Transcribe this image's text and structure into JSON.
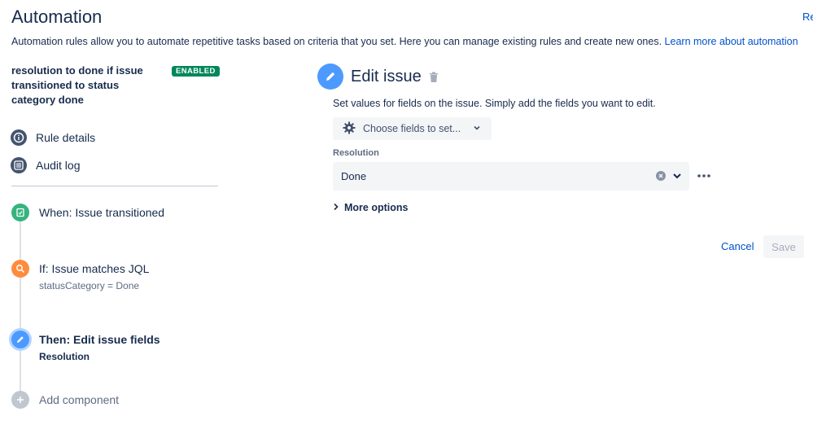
{
  "header": {
    "title": "Automation",
    "top_right_link": "Re",
    "intro_text": "Automation rules allow you to automate repetitive tasks based on criteria that you set. Here you can manage existing rules and create new ones.",
    "intro_link": "Learn more about automation"
  },
  "rule": {
    "name": "resolution to done if issue transitioned to status category done",
    "status_badge": "ENABLED"
  },
  "nav": {
    "rule_details": "Rule details",
    "audit_log": "Audit log"
  },
  "steps": [
    {
      "title": "When: Issue transitioned",
      "subtitle": "",
      "color": "#36b37e",
      "icon": "trigger-icon"
    },
    {
      "title": "If: Issue matches JQL",
      "subtitle": "statusCategory = Done",
      "color": "#ff8b3d",
      "icon": "search-icon"
    },
    {
      "title": "Then: Edit issue fields",
      "subtitle": "Resolution",
      "color": "#4c9aff",
      "icon": "pencil-icon"
    },
    {
      "title": "Add component",
      "subtitle": "",
      "color": "#c1c7d0",
      "icon": "plus-icon"
    }
  ],
  "editor": {
    "title": "Edit issue",
    "help_text": "Set values for fields on the issue. Simply add the fields you want to edit.",
    "choose_fields_label": "Choose fields to set...",
    "resolution_label": "Resolution",
    "resolution_value": "Done",
    "more_options_label": "More options",
    "cancel_label": "Cancel",
    "save_label": "Save"
  },
  "colors": {
    "accent": "#0052cc",
    "enabled_badge": "#00875a"
  }
}
